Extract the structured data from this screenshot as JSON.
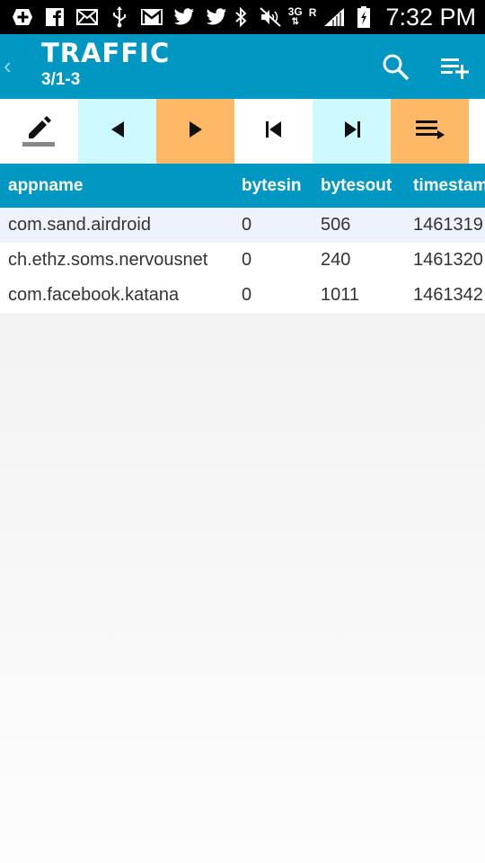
{
  "status_bar": {
    "time": "7:32 PM",
    "network": "3G",
    "roaming": "R",
    "left_icons": [
      "add-box-icon",
      "facebook-icon",
      "mail-icon",
      "usb-icon",
      "gmail-icon",
      "twitter-icon",
      "twitter-icon"
    ],
    "right_icons": [
      "bluetooth-icon",
      "mute-icon",
      "signal-icon",
      "battery-charging-icon"
    ]
  },
  "action_bar": {
    "title": "TRAFFIC",
    "subtitle": "3/1-3",
    "colors": {
      "background": "#0097c2",
      "back_chevron": "#8fd3ea"
    }
  },
  "toolbar": {
    "buttons": [
      {
        "icon": "edit-icon",
        "bg": "#ffffff"
      },
      {
        "icon": "previous-icon",
        "bg": "#ccfaff"
      },
      {
        "icon": "next-icon",
        "bg": "#ffb866"
      },
      {
        "icon": "skip-first-icon",
        "bg": "#ffffff"
      },
      {
        "icon": "skip-last-icon",
        "bg": "#ccfaff"
      },
      {
        "icon": "playlist-icon",
        "bg": "#ffb866"
      }
    ]
  },
  "table": {
    "columns": [
      "appname",
      "bytesin",
      "bytesout",
      "timestam"
    ],
    "rows": [
      {
        "appname": "com.sand.airdroid",
        "bytesin": "0",
        "bytesout": "506",
        "timestamp": "1461319"
      },
      {
        "appname": "ch.ethz.soms.nervousnet",
        "bytesin": "0",
        "bytesout": "240",
        "timestamp": "1461320"
      },
      {
        "appname": "com.facebook.katana",
        "bytesin": "0",
        "bytesout": "1011",
        "timestamp": "1461342"
      }
    ]
  }
}
